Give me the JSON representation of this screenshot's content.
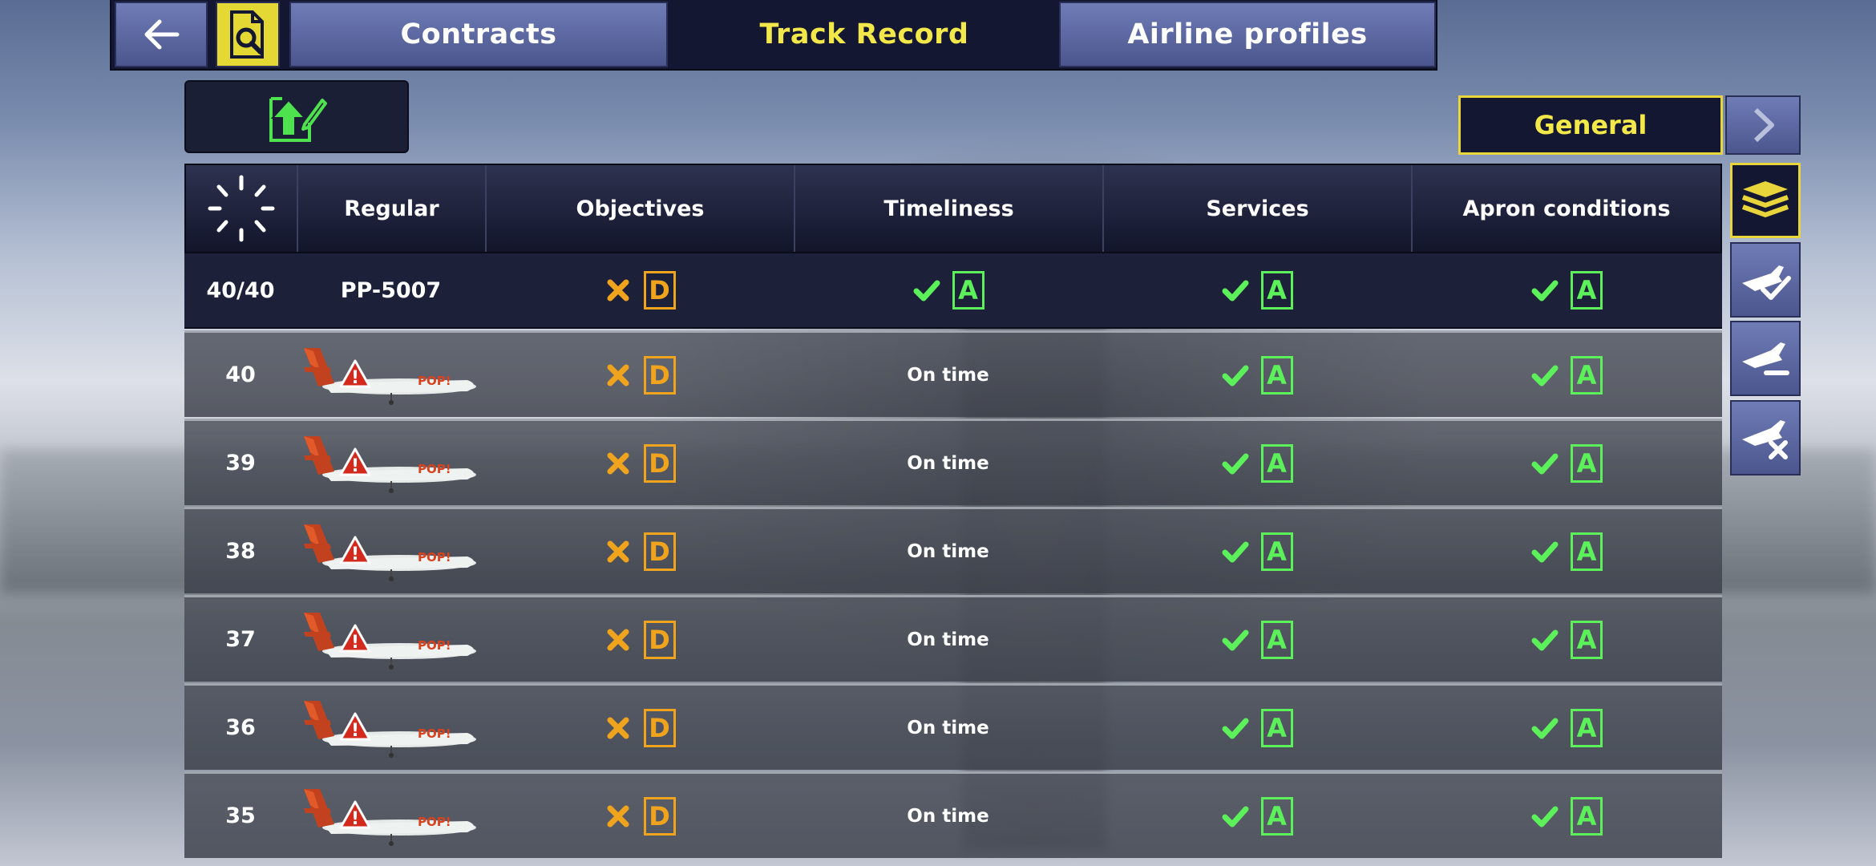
{
  "tabs": {
    "contracts": "Contracts",
    "track_record": "Track Record",
    "airline_profiles": "Airline profiles"
  },
  "filter": {
    "selected": "General"
  },
  "table": {
    "headers": {
      "regular": "Regular",
      "objectives": "Objectives",
      "timeliness": "Timeliness",
      "services": "Services",
      "apron": "Apron conditions"
    },
    "summary": {
      "count": "40/40",
      "registration": "PP-5007",
      "objectives_grade": "D",
      "timeliness_grade": "A",
      "services_grade": "A",
      "apron_grade": "A"
    },
    "rows": [
      {
        "num": "40",
        "timeliness": "On time",
        "objectives_grade": "D",
        "services_grade": "A",
        "apron_grade": "A"
      },
      {
        "num": "39",
        "timeliness": "On time",
        "objectives_grade": "D",
        "services_grade": "A",
        "apron_grade": "A"
      },
      {
        "num": "38",
        "timeliness": "On time",
        "objectives_grade": "D",
        "services_grade": "A",
        "apron_grade": "A"
      },
      {
        "num": "37",
        "timeliness": "On time",
        "objectives_grade": "D",
        "services_grade": "A",
        "apron_grade": "A"
      },
      {
        "num": "36",
        "timeliness": "On time",
        "objectives_grade": "D",
        "services_grade": "A",
        "apron_grade": "A"
      },
      {
        "num": "35",
        "timeliness": "On time",
        "objectives_grade": "D",
        "services_grade": "A",
        "apron_grade": "A"
      }
    ],
    "aircraft_livery_text": "POP!"
  },
  "colors": {
    "accent": "#f3e84a",
    "grade_pass": "#5cf05a",
    "grade_fail": "#f0a41e",
    "warning": "#d42a1e"
  },
  "icons": [
    "back-arrow-icon",
    "document-search-icon",
    "upload-edit-icon",
    "chevron-right-icon",
    "stack-all-icon",
    "plane-landed-check-icon",
    "plane-takeoff-icon",
    "plane-cancelled-icon",
    "loading-spinner-icon",
    "warning-icon",
    "check-icon",
    "cross-icon"
  ]
}
